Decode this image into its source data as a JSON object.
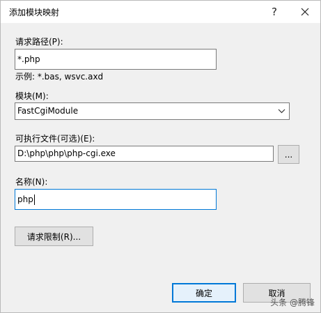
{
  "window": {
    "title": "添加模块映射",
    "help_glyph": "?",
    "icons": {
      "close": "close-icon",
      "dropdown": "chevron-down-icon"
    }
  },
  "request_path": {
    "label": "请求路径(P):",
    "value": "*.php",
    "example": "示例: *.bas, wsvc.axd"
  },
  "module": {
    "label": "模块(M):",
    "selected": "FastCgiModule"
  },
  "executable": {
    "label": "可执行文件(可选)(E):",
    "value": "D:\\php\\php\\php-cgi.exe",
    "browse_label": "..."
  },
  "name": {
    "label": "名称(N):",
    "value": "php"
  },
  "buttons": {
    "request_restrictions": "请求限制(R)...",
    "ok": "确定",
    "cancel": "取消"
  },
  "watermark": "头条 @腾锋"
}
